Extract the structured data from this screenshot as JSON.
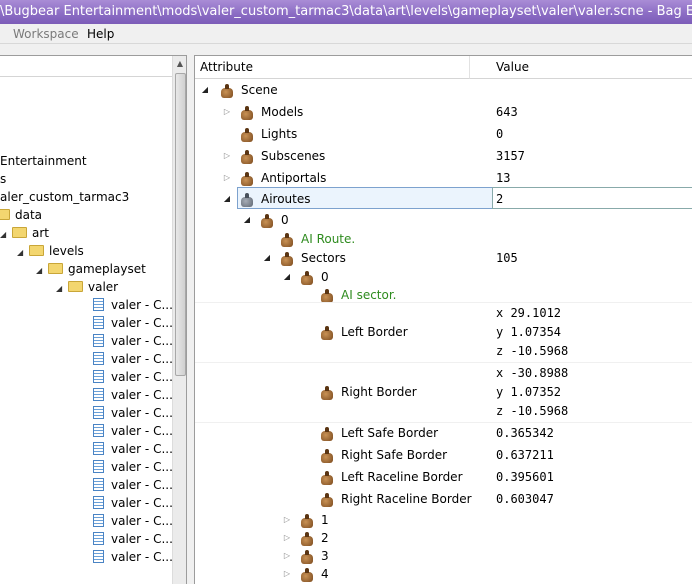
{
  "window": {
    "title": "\\Bugbear Entertainment\\mods\\valer_custom_tarmac3\\data\\art\\levels\\gameplayset\\valer\\valer.scne - Bag Edit"
  },
  "menu": {
    "workspace": "Workspace",
    "help": "Help"
  },
  "left_tree": {
    "items": [
      {
        "label": "Entertainment",
        "type": "text"
      },
      {
        "label": "s",
        "type": "text"
      },
      {
        "label": "aler_custom_tarmac3",
        "type": "text"
      },
      {
        "label": "data",
        "type": "folder"
      },
      {
        "label": "art",
        "type": "folder"
      },
      {
        "label": "levels",
        "type": "folder"
      },
      {
        "label": "gameplayset",
        "type": "folder"
      },
      {
        "label": "valer",
        "type": "folder"
      }
    ],
    "files": [
      "valer - C...",
      "valer - C...",
      "valer - C...",
      "valer - C...",
      "valer - C...",
      "valer - C...",
      "valer - C...",
      "valer - C...",
      "valer - C...",
      "valer - C...",
      "valer - C...",
      "valer - C...",
      "valer - C...",
      "valer - C...",
      "valer - C..."
    ]
  },
  "grid": {
    "headers": {
      "attribute": "Attribute",
      "value": "Value"
    },
    "rows": [
      {
        "label": "Scene",
        "value": ""
      },
      {
        "label": "Models",
        "value": "643"
      },
      {
        "label": "Lights",
        "value": "0"
      },
      {
        "label": "Subscenes",
        "value": "3157"
      },
      {
        "label": "Antiportals",
        "value": "13"
      },
      {
        "label": "Airoutes",
        "value": "2"
      },
      {
        "label": "0",
        "value": ""
      },
      {
        "label": "AI Route.",
        "value": ""
      },
      {
        "label": "Sectors",
        "value": "105"
      },
      {
        "label": "0",
        "value": ""
      },
      {
        "label": "AI sector.",
        "value": ""
      },
      {
        "label": "Left Border",
        "value": ""
      },
      {
        "label": "Right Border",
        "value": ""
      },
      {
        "label": "Left Safe Border",
        "value": "0.365342"
      },
      {
        "label": "Right Safe Border",
        "value": "0.637211"
      },
      {
        "label": "Left Raceline Border",
        "value": "0.395601"
      },
      {
        "label": "Right Raceline Border",
        "value": "0.603047"
      },
      {
        "label": "1",
        "value": ""
      },
      {
        "label": "2",
        "value": ""
      },
      {
        "label": "3",
        "value": ""
      },
      {
        "label": "4",
        "value": ""
      }
    ],
    "left_border": {
      "x": "x 29.1012",
      "y": "y 1.07354",
      "z": "z -10.5968"
    },
    "right_border": {
      "x": "x -30.8988",
      "y": "y 1.07352",
      "z": "z -10.5968"
    }
  },
  "colors": {
    "title_bar": "#8a6bc3",
    "comment_text": "#2e8b1e",
    "selection": "#ebf4fd"
  },
  "icons": {
    "tree_node": "bag-icon",
    "folder": "folder-icon",
    "file": "document-icon"
  }
}
